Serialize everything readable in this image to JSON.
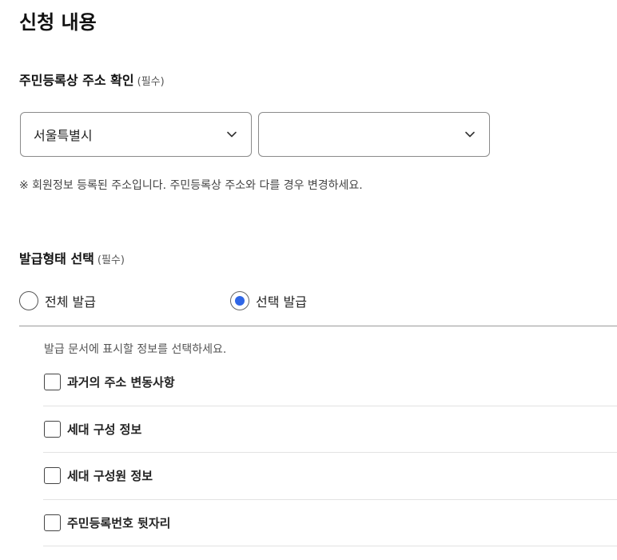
{
  "page_title": "신청 내용",
  "address_section": {
    "label": "주민등록상 주소 확인",
    "required": "(필수)",
    "select1_value": "서울특별시",
    "select2_value": "",
    "notice": "※ 회원정보 등록된 주소입니다. 주민등록상 주소와 다를 경우 변경하세요."
  },
  "issue_section": {
    "label": "발급형태 선택",
    "required": "(필수)",
    "options": [
      {
        "label": "전체 발급",
        "checked": false
      },
      {
        "label": "선택 발급",
        "checked": true
      }
    ],
    "helper": "발급 문서에 표시할 정보를 선택하세요.",
    "items": [
      {
        "label": "과거의 주소 변동사항",
        "checked": false
      },
      {
        "label": "세대 구성 정보",
        "checked": false
      },
      {
        "label": "세대 구성원 정보",
        "checked": false
      },
      {
        "label": "주민등록번호 뒷자리",
        "checked": false
      }
    ]
  },
  "colors": {
    "accent": "#2f66e6",
    "border": "#8a8a8a",
    "divider": "#9a9a9a"
  },
  "icons": {
    "dropdown": "chevron-down-icon"
  }
}
